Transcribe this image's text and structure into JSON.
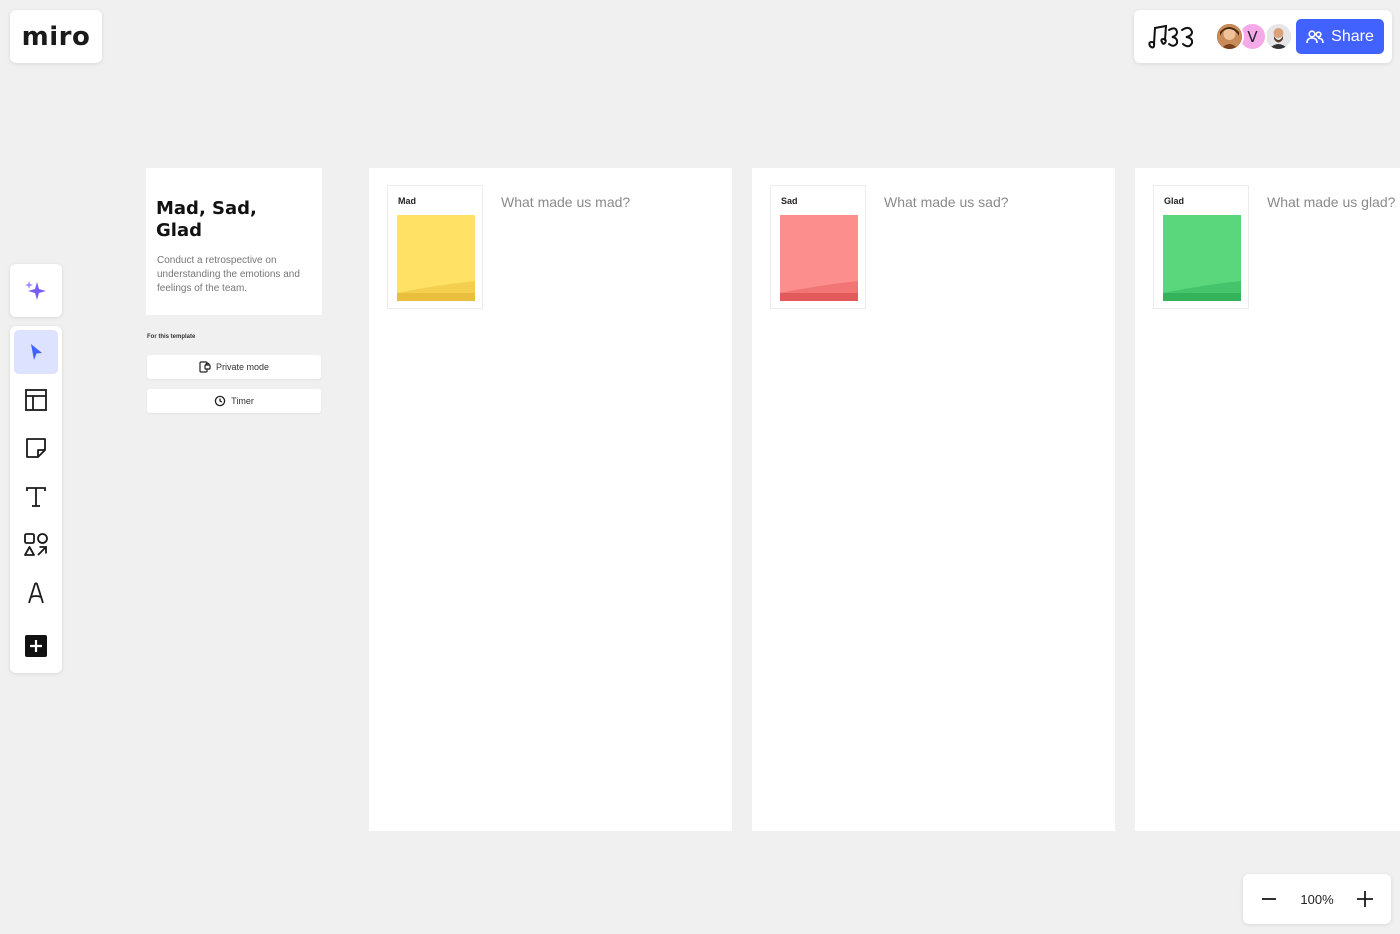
{
  "app": {
    "logo": "miro"
  },
  "header": {
    "board_glyph": "♫ʖ3",
    "avatars": [
      {
        "name": "avatar-photo-1"
      },
      {
        "initial": "V",
        "color": "#f5a9e8"
      },
      {
        "name": "avatar-photo-2"
      }
    ],
    "share_label": "Share",
    "accent_color": "#4262ff"
  },
  "toolbar": {
    "ai_icon": "sparkle-icon",
    "tools": [
      {
        "name": "select",
        "icon": "cursor-icon",
        "active": true
      },
      {
        "name": "templates",
        "icon": "layout-icon"
      },
      {
        "name": "sticky-note",
        "icon": "sticky-note-icon"
      },
      {
        "name": "text",
        "icon": "text-icon"
      },
      {
        "name": "shapes",
        "icon": "shapes-icon"
      },
      {
        "name": "pen",
        "icon": "pen-icon"
      },
      {
        "name": "more",
        "icon": "plus-square-icon"
      }
    ]
  },
  "template": {
    "title": "Mad, Sad, Glad",
    "description": "Conduct a retrospective on understanding the emotions and feelings of the team.",
    "for_this_template": "For this template",
    "buttons": [
      {
        "label": "Private mode",
        "icon": "private-mode-icon"
      },
      {
        "label": "Timer",
        "icon": "timer-icon"
      }
    ]
  },
  "columns": [
    {
      "label": "Mad",
      "question": "What made us mad?",
      "sticky_color": "#ffe165",
      "sticky_bottom": "#e9bf3d"
    },
    {
      "label": "Sad",
      "question": "What made us sad?",
      "sticky_color": "#fd8e8e",
      "sticky_bottom": "#e25a5a"
    },
    {
      "label": "Glad",
      "question": "What made us glad?",
      "sticky_color": "#5ad67d",
      "sticky_bottom": "#34b35b"
    }
  ],
  "zoom": {
    "level": "100%"
  }
}
